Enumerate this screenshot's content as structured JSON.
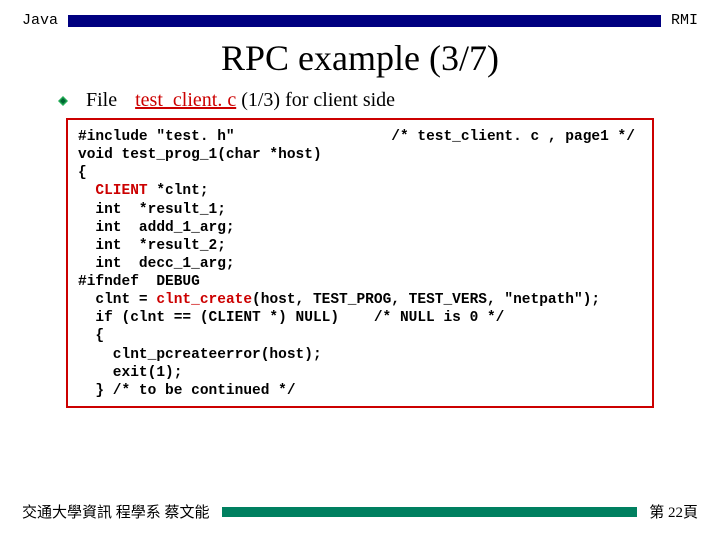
{
  "header": {
    "left": "Java",
    "right": "RMI",
    "rule_color": "#000080"
  },
  "title": "RPC example  (3/7)",
  "file_line": {
    "label": "File",
    "filename": "test_client. c",
    "rest": " (1/3)  for client side"
  },
  "code": {
    "l1a": "#include \"test. h\"",
    "l1b": "                  /* test_client. c , page1 */",
    "l2": "void test_prog_1(char *host)",
    "l3": "{",
    "l4a": "  ",
    "l4b": "CLIENT",
    "l4c": " *clnt;",
    "l5": "  int  *result_1;",
    "l6": "  int  addd_1_arg;",
    "l7": "  int  *result_2;",
    "l8": "  int  decc_1_arg;",
    "l9": "#ifndef  DEBUG",
    "l10a": "  clnt = ",
    "l10b": "clnt_create",
    "l10c": "(host, TEST_PROG, TEST_VERS, \"netpath\");",
    "l11": "  if (clnt == (CLIENT *) NULL)    /* NULL is 0 */",
    "l12": "  {",
    "l13": "    clnt_pcreateerror(host);",
    "l14": "    exit(1);",
    "l15": "  } /* to be continued */"
  },
  "footer": {
    "left": "交通大學資訊 程學系 蔡文能",
    "right": "第 22頁",
    "rule_color": "#008060"
  }
}
